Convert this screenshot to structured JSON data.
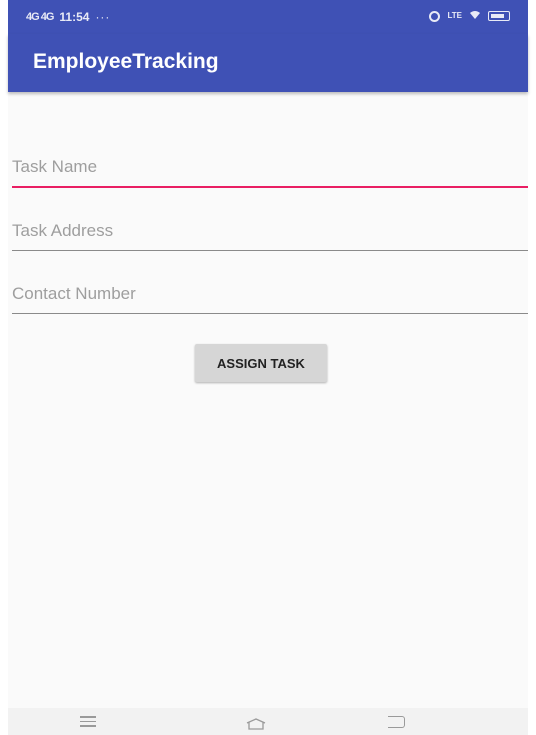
{
  "status_bar": {
    "signal_text": "4G 4G",
    "time": "11:54",
    "more": "···",
    "network_label": "LTE",
    "icons": [
      "signal-icon",
      "alarm-icon",
      "lte-icon",
      "wifi-icon",
      "battery-icon"
    ]
  },
  "app_bar": {
    "title": "EmployeeTracking",
    "color": "#3f51b5"
  },
  "form": {
    "task_name_placeholder": "Task Name",
    "task_address_placeholder": "Task Address",
    "contact_number_placeholder": "Contact Number",
    "focus_color": "#e91e63"
  },
  "actions": {
    "assign_label": "ASSIGN TASK"
  },
  "nav_bar": {
    "icons": [
      "menu-icon",
      "home-icon",
      "back-icon"
    ]
  }
}
